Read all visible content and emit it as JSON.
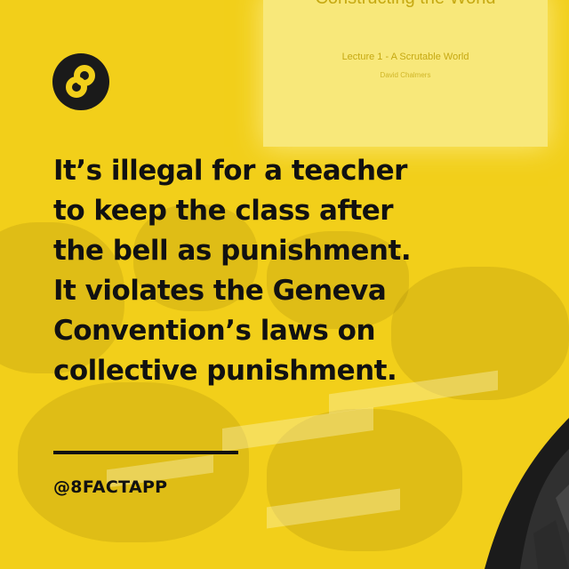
{
  "background": {
    "color": "#f2cf1a",
    "slide": {
      "title": "Constructing the World",
      "subtitle": "Lecture 1 - A Scrutable World",
      "caption": "David Chalmers"
    }
  },
  "logo": {
    "icon": "infinity-eight-icon",
    "color": "#1a1a1a",
    "glyph_color": "#f2cf1a"
  },
  "fact": {
    "text_lines": [
      "It’s illegal for a teacher",
      "to keep the class after",
      "the bell as punishment.",
      "It violates the Geneva",
      "Convention’s laws on",
      "collective punishment."
    ],
    "text_color": "#111111"
  },
  "footer": {
    "handle": "@8FACTAPP"
  }
}
